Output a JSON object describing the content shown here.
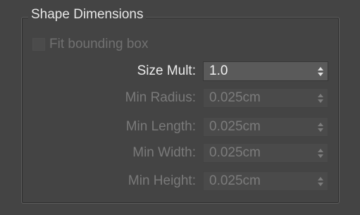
{
  "group": {
    "title": "Shape Dimensions"
  },
  "fit_bounding_box": {
    "label": "Fit bounding box",
    "checked": false,
    "enabled": false
  },
  "fields": [
    {
      "label": "Size Mult:",
      "value": "1.0",
      "enabled": true
    },
    {
      "label": "Min Radius:",
      "value": "0.025cm",
      "enabled": false
    },
    {
      "label": "Min Length:",
      "value": "0.025cm",
      "enabled": false
    },
    {
      "label": "Min Width:",
      "value": "0.025cm",
      "enabled": false
    },
    {
      "label": "Min Height:",
      "value": "0.025cm",
      "enabled": false
    }
  ],
  "icons": {
    "spinner_arrows": "spinner-arrows-icon"
  },
  "colors": {
    "panel_bg": "#444444",
    "enabled_text": "#ececec",
    "disabled_text": "#7a7a7a"
  }
}
